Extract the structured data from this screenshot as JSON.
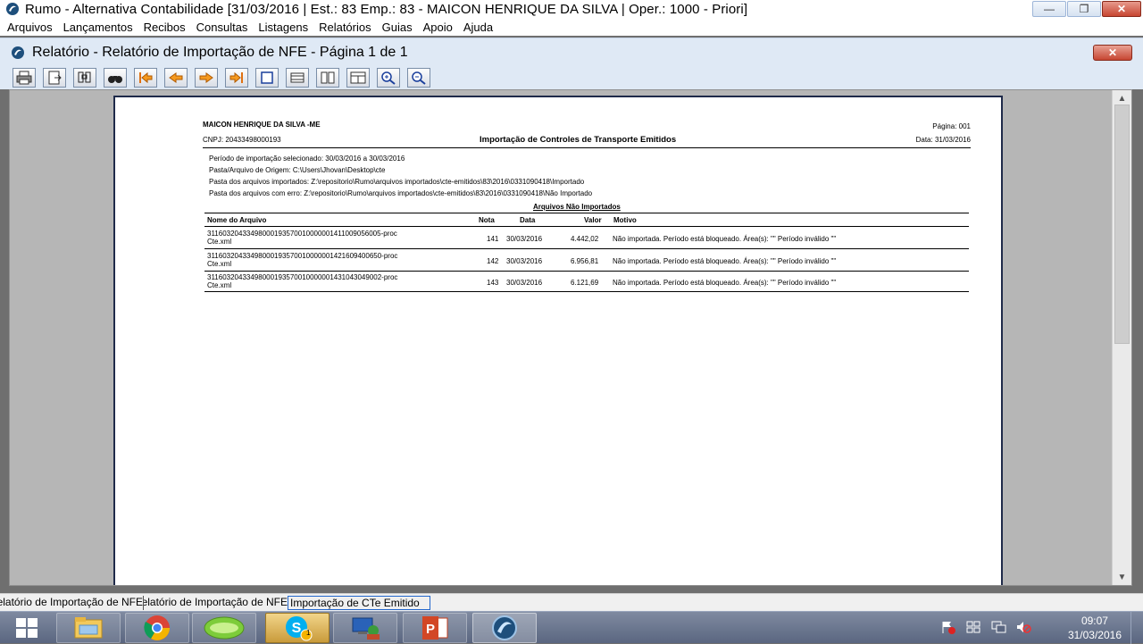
{
  "window": {
    "title": "Rumo - Alternativa Contabilidade [31/03/2016 | Est.: 83 Emp.: 83 - MAICON HENRIQUE DA SILVA | Oper.: 1000 - Priori]",
    "controls": {
      "minimize": "—",
      "maximize": "❐",
      "close": "✕"
    }
  },
  "menu": [
    "Arquivos",
    "Lançamentos",
    "Recibos",
    "Consultas",
    "Listagens",
    "Relatórios",
    "Guias",
    "Apoio",
    "Ajuda"
  ],
  "report_window": {
    "title": "Relatório - Relatório de Importação de NFE - Página 1 de 1",
    "close": "✕"
  },
  "toolbar": {
    "buttons": [
      "print-icon",
      "export-icon",
      "search-icon",
      "binoculars-icon",
      "first-page-icon",
      "prev-page-icon",
      "next-page-icon",
      "last-page-icon",
      "page-width-icon",
      "page-setup-icon",
      "two-pages-icon",
      "multi-page-icon",
      "zoom-in-icon",
      "zoom-out-icon"
    ]
  },
  "report": {
    "company": "MAICON HENRIQUE DA SILVA -ME",
    "cnpj": "CNPJ: 20433498000193",
    "title": "Importação de Controles de Transporte Emitidos",
    "page": "Página: 001",
    "date": "Data: 31/03/2016",
    "info": [
      "Período de importação selecionado: 30/03/2016 a 30/03/2016",
      "Pasta/Arquivo de Origem: C:\\Users\\Jhovan\\Desktop\\cte",
      "Pasta dos arquivos importados: Z:\\repositorio\\Rumo\\arquivos importados\\cte-emitidos\\83\\2016\\0331090418\\Importado",
      "Pasta dos arquivos com erro: Z:\\repositorio\\Rumo\\arquivos importados\\cte-emitidos\\83\\2016\\0331090418\\Não Importado"
    ],
    "section_title": "Arquivos Não Importados",
    "columns": [
      "Nome do Arquivo",
      "Nota",
      "Data",
      "Valor",
      "Motivo"
    ],
    "rows": [
      {
        "file1": "31160320433498000193570010000001411009056005-proc",
        "file2": "Cte.xml",
        "nota": "141",
        "data": "30/03/2016",
        "valor": "4.442,02",
        "motivo": "Não importada. Período está bloqueado. Área(s): \"\" Período inválido \"\""
      },
      {
        "file1": "31160320433498000193570010000001421609400650-proc",
        "file2": "Cte.xml",
        "nota": "142",
        "data": "30/03/2016",
        "valor": "6.956,81",
        "motivo": "Não importada. Período está bloqueado. Área(s): \"\" Período inválido \"\""
      },
      {
        "file1": "31160320433498000193570010000001431043049002-proc",
        "file2": "Cte.xml",
        "nota": "143",
        "data": "30/03/2016",
        "valor": "6.121,69",
        "motivo": "Não importada. Período está bloqueado. Área(s): \"\" Período inválido \"\""
      }
    ]
  },
  "statusbar": [
    "Relatório de Importação de NFE",
    "Relatório de Importação de NFE",
    "Importação de CTe Emitido"
  ],
  "taskbar": {
    "apps": [
      "windows-explorer",
      "chrome",
      "unknown-green",
      "skype",
      "remote-desktop",
      "powerpoint",
      "rumo"
    ],
    "skype_badge": "1",
    "clock_time": "09:07",
    "clock_date": "31/03/2016"
  }
}
